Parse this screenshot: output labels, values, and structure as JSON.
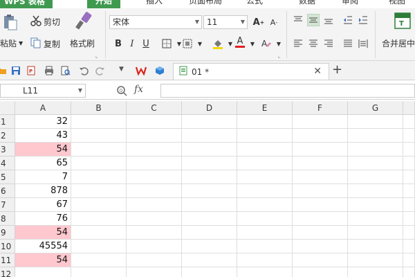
{
  "app": {
    "menu_label": "WPS 表格"
  },
  "ribbon_tabs": [
    {
      "label": "开始",
      "active": true
    },
    {
      "label": "插入",
      "active": false
    },
    {
      "label": "页面布局",
      "active": false
    },
    {
      "label": "公式",
      "active": false
    },
    {
      "label": "数据",
      "active": false
    },
    {
      "label": "审阅",
      "active": false
    },
    {
      "label": "视图",
      "active": false
    }
  ],
  "clipboard": {
    "paste_label": "粘贴",
    "cut_label": "剪切",
    "copy_label": "复制",
    "format_painter_label": "格式刷"
  },
  "font": {
    "name": "宋体",
    "size": "11"
  },
  "merge": {
    "label": "合并居中"
  },
  "doc_tab": {
    "title": "01 *"
  },
  "formula_bar": {
    "cell_ref": "L11",
    "fx_label": "fx",
    "value": ""
  },
  "columns": [
    "A",
    "B",
    "C",
    "D",
    "E",
    "F",
    "G"
  ],
  "rows": [
    {
      "num": "1",
      "a": "32",
      "highlight": false
    },
    {
      "num": "2",
      "a": "43",
      "highlight": false
    },
    {
      "num": "3",
      "a": "54",
      "highlight": true
    },
    {
      "num": "4",
      "a": "65",
      "highlight": false
    },
    {
      "num": "5",
      "a": "7",
      "highlight": false
    },
    {
      "num": "6",
      "a": "878",
      "highlight": false
    },
    {
      "num": "7",
      "a": "67",
      "highlight": false
    },
    {
      "num": "8",
      "a": "76",
      "highlight": false
    },
    {
      "num": "9",
      "a": "54",
      "highlight": true
    },
    {
      "num": "10",
      "a": "45554",
      "highlight": false
    },
    {
      "num": "11",
      "a": "54",
      "highlight": true
    },
    {
      "num": "12",
      "a": "",
      "highlight": false
    }
  ],
  "colors": {
    "accent_green": "#3f9a4f",
    "duplicate_fill": "#ffc7ce",
    "header_bg": "#f0f0f0",
    "grid_line": "#dedede"
  }
}
